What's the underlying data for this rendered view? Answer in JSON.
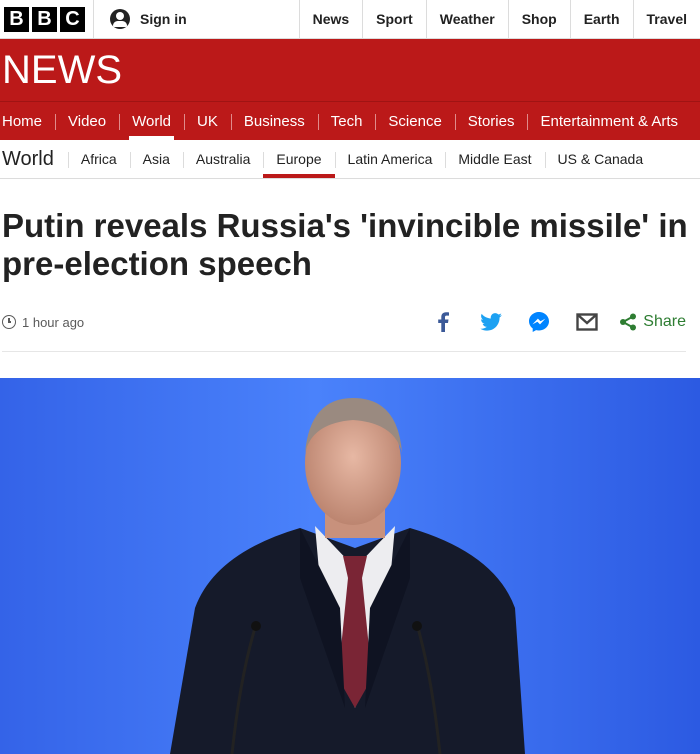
{
  "topbar": {
    "logo": [
      "B",
      "B",
      "C"
    ],
    "signin_label": "Sign in",
    "nav": [
      "News",
      "Sport",
      "Weather",
      "Shop",
      "Earth",
      "Travel"
    ]
  },
  "banner": {
    "title": "NEWS",
    "color": "#bb1919"
  },
  "section_nav": {
    "items": [
      "Home",
      "Video",
      "World",
      "UK",
      "Business",
      "Tech",
      "Science",
      "Stories",
      "Entertainment & Arts"
    ],
    "active": "World"
  },
  "sub_nav": {
    "title": "World",
    "items": [
      "Africa",
      "Asia",
      "Australia",
      "Europe",
      "Latin America",
      "Middle East",
      "US & Canada"
    ],
    "active": "Europe"
  },
  "article": {
    "headline": "Putin reveals Russia's 'invincible missile' in pre-election speech",
    "timestamp": "1 hour ago",
    "share_label": "Share"
  },
  "share_icons": [
    "facebook-icon",
    "twitter-icon",
    "messenger-icon",
    "email-icon",
    "share-icon"
  ],
  "colors": {
    "facebook": "#3b5998",
    "twitter": "#1da1f2",
    "messenger": "#0084ff",
    "share": "#2e7d32"
  }
}
